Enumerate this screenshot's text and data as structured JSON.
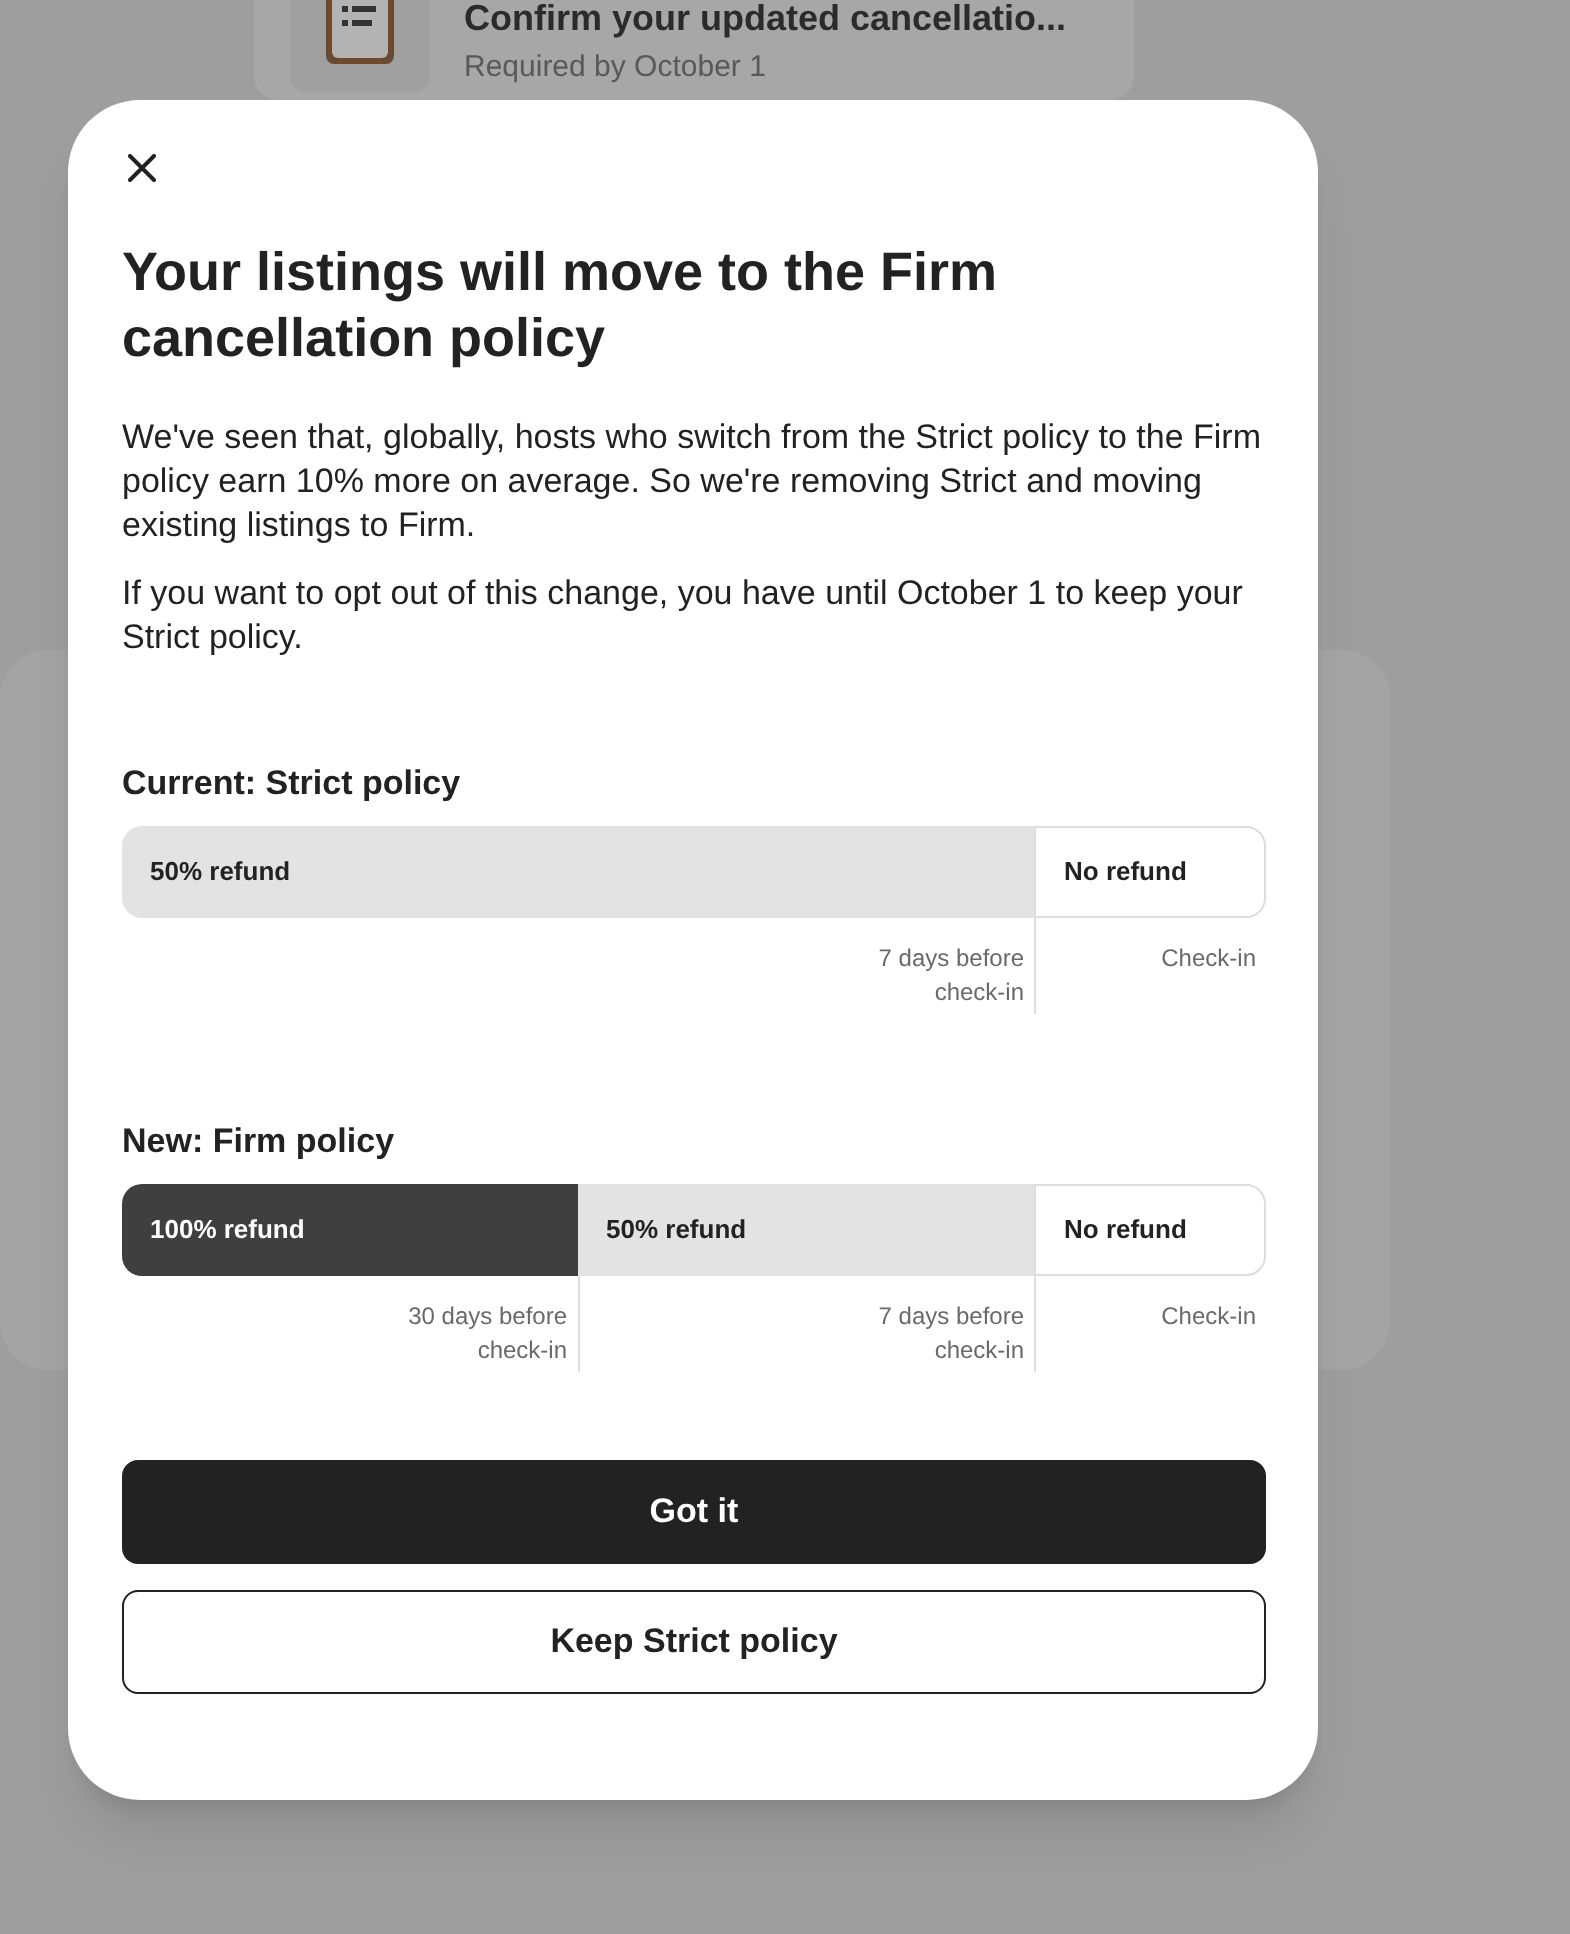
{
  "background_card": {
    "title": "Confirm your updated cancellatio...",
    "subtitle": "Required by October 1"
  },
  "modal": {
    "title": "Your listings will move to the Firm cancellation policy",
    "paragraphs": [
      "We've seen that, globally, hosts who switch from the Strict policy to the Firm policy earn 10% more on average. So we're removing Strict and moving existing listings to Firm.",
      "If you want to opt out of this change, you have until October 1 to keep your Strict policy."
    ],
    "policies": [
      {
        "heading": "Current: Strict policy",
        "segments": [
          {
            "label": "50% refund",
            "kind": "partial",
            "marker": "7 days before check-in"
          },
          {
            "label": "No refund",
            "kind": "none",
            "marker": "Check-in"
          }
        ]
      },
      {
        "heading": "New: Firm policy",
        "segments": [
          {
            "label": "100% refund",
            "kind": "full",
            "marker": "30 days before check-in"
          },
          {
            "label": "50% refund",
            "kind": "partial",
            "marker": "7 days before check-in"
          },
          {
            "label": "No refund",
            "kind": "none",
            "marker": "Check-in"
          }
        ]
      }
    ],
    "buttons": [
      {
        "label": "Got it",
        "kind": "primary"
      },
      {
        "label": "Keep Strict policy",
        "kind": "secondary"
      }
    ]
  }
}
